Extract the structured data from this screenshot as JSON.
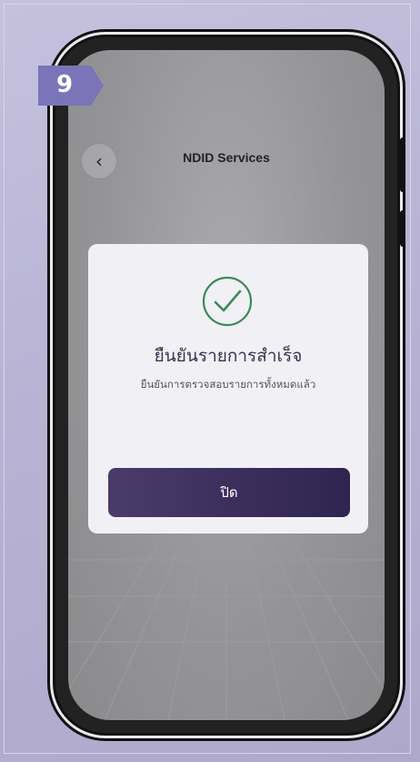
{
  "step_badge": {
    "number": "9",
    "color": "#7b74b8"
  },
  "header": {
    "title": "NDID Services",
    "back_icon": "chevron-left-icon"
  },
  "modal": {
    "icon": "check-circle-icon",
    "icon_color": "#3a8a5a",
    "title": "ยืนยันรายการสำเร็จ",
    "subtitle": "ยืนยันการตรวจสอบรายการทั้งหมดแล้ว",
    "close_label": "ปิด"
  },
  "colors": {
    "button": "#3a2d5a",
    "background": "#b8b3d4"
  }
}
